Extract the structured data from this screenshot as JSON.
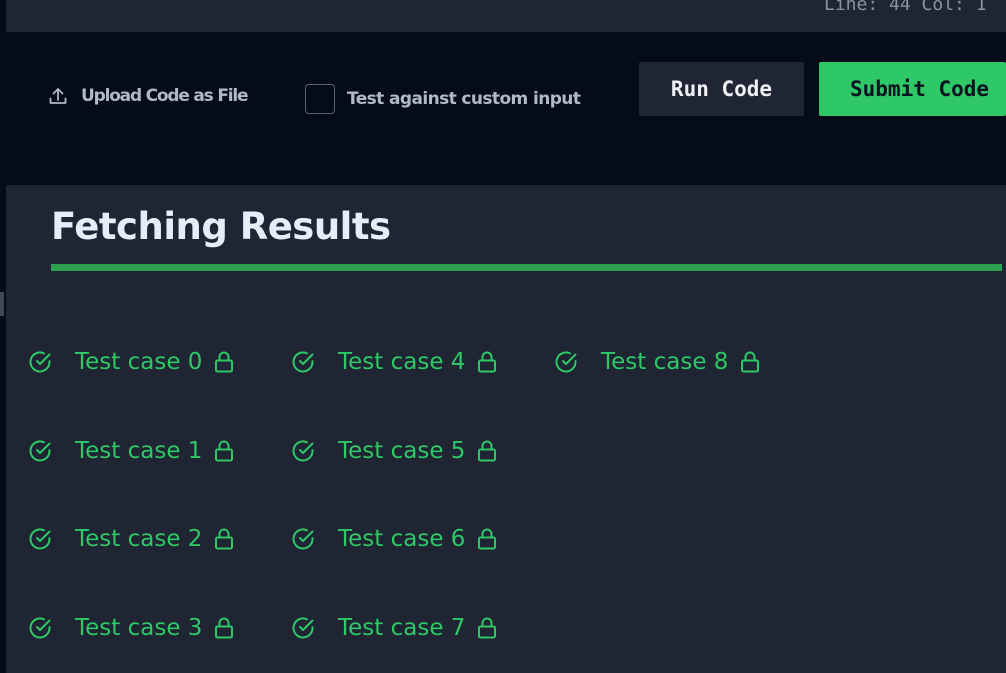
{
  "editor": {
    "cursor_position": "Line: 44 Col: 1"
  },
  "toolbar": {
    "upload_label": "Upload Code as File",
    "custom_input_label": "Test against custom input",
    "custom_input_checked": false,
    "run_label": "Run Code",
    "submit_label": "Submit Code"
  },
  "results": {
    "title": "Fetching Results",
    "test_cases": [
      {
        "label": "Test case 0",
        "status": "passed",
        "locked": true
      },
      {
        "label": "Test case 1",
        "status": "passed",
        "locked": true
      },
      {
        "label": "Test case 2",
        "status": "passed",
        "locked": true
      },
      {
        "label": "Test case 3",
        "status": "passed",
        "locked": true
      },
      {
        "label": "Test case 4",
        "status": "passed",
        "locked": true
      },
      {
        "label": "Test case 5",
        "status": "passed",
        "locked": true
      },
      {
        "label": "Test case 6",
        "status": "passed",
        "locked": true
      },
      {
        "label": "Test case 7",
        "status": "passed",
        "locked": true
      },
      {
        "label": "Test case 8",
        "status": "passed",
        "locked": true
      }
    ]
  },
  "icons": {
    "upload": "upload-icon",
    "passed": "check-circle-icon",
    "locked": "lock-icon"
  },
  "colors": {
    "accent_green": "#2ec866",
    "progress_green": "#2ea14f",
    "panel": "#1f2532",
    "background": "#050b19"
  }
}
